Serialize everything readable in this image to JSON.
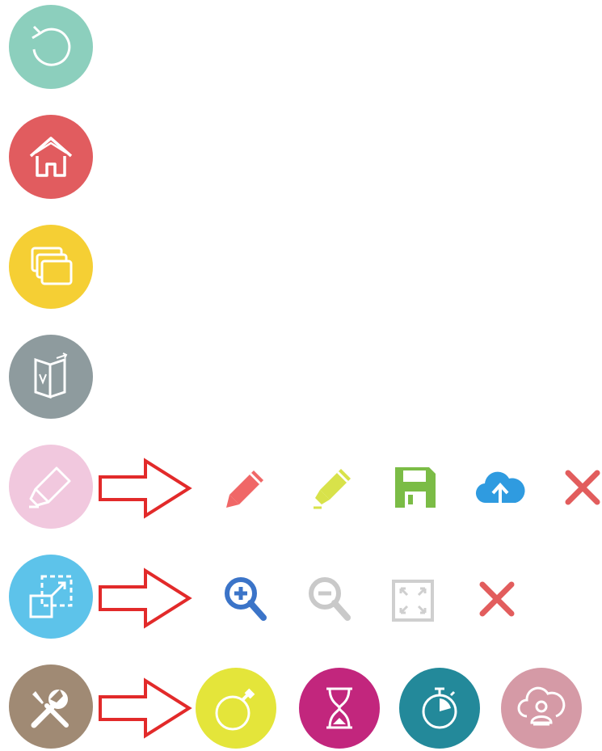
{
  "sidebar": {
    "buttons": [
      {
        "id": "undo",
        "icon": "rotate-ccw-icon",
        "color": "#8ccfbd"
      },
      {
        "id": "home",
        "icon": "home-icon",
        "color": "#e15c5f"
      },
      {
        "id": "pages",
        "icon": "stacked-windows-icon",
        "color": "#f5cf34"
      },
      {
        "id": "book",
        "icon": "book-door-icon",
        "color": "#8e9b9e"
      },
      {
        "id": "marker",
        "icon": "highlighter-icon",
        "color": "#f1c8de"
      },
      {
        "id": "select-area",
        "icon": "dashed-resize-icon",
        "color": "#5dc3ea"
      },
      {
        "id": "tools",
        "icon": "wrench-screwdriver-icon",
        "color": "#a08a74"
      }
    ]
  },
  "arrow_color": "#e22a2a",
  "marker_toolbar": [
    {
      "id": "pencil",
      "icon": "pencil-icon",
      "color": "#f06767"
    },
    {
      "id": "highlighter",
      "icon": "highlighter-pen-icon",
      "color": "#d8e24a"
    },
    {
      "id": "save",
      "icon": "floppy-disk-icon",
      "color": "#7bbc46"
    },
    {
      "id": "upload",
      "icon": "cloud-upload-icon",
      "color": "#2f9be0"
    },
    {
      "id": "close",
      "icon": "close-icon",
      "color": "#e25d5d"
    }
  ],
  "zoom_toolbar": [
    {
      "id": "zoom-in",
      "icon": "zoom-in-icon",
      "color": "#3b74c8"
    },
    {
      "id": "zoom-out",
      "icon": "zoom-out-icon",
      "color": "#c9c9c9"
    },
    {
      "id": "fit-screen",
      "icon": "fit-screen-icon",
      "color": "#cfcfcf"
    },
    {
      "id": "close",
      "icon": "close-icon",
      "color": "#e25d5d"
    }
  ],
  "tools_toolbar": [
    {
      "id": "bomb",
      "icon": "bomb-icon",
      "color": "#e4e53a"
    },
    {
      "id": "hourglass",
      "icon": "hourglass-icon",
      "color": "#c2267d"
    },
    {
      "id": "stopwatch",
      "icon": "stopwatch-icon",
      "color": "#23899a"
    },
    {
      "id": "reader",
      "icon": "cloud-person-icon",
      "color": "#d59aa6"
    }
  ]
}
